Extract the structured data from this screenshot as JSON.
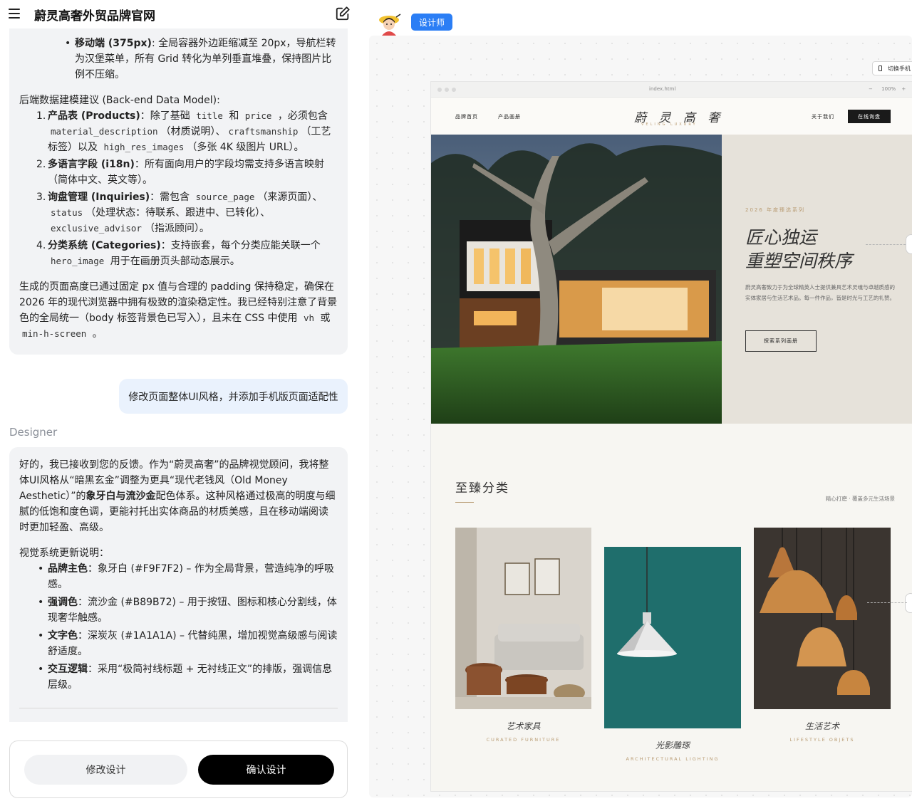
{
  "app": {
    "title": "蔚灵高奢外贸品牌官网"
  },
  "chat": {
    "msg1": {
      "mobile_bullet_bold": "移动端 (375px)",
      "mobile_bullet_text": ": 全局容器外边距缩减至 20px，导航栏转为汉堡菜单，所有 Grid 转化为单列垂直堆叠，保持图片比例不压缩。",
      "data_model_heading": "后端数据建模建议 (Back-end Data Model):",
      "items": [
        {
          "num": "1.",
          "bold": "产品表 (Products)",
          "parts": [
            "：除了基础 ",
            "title",
            " 和 ",
            "price",
            " ，必须包含 ",
            "material_description",
            "（材质说明）、",
            "craftsmanship",
            "（工艺标签）以及 ",
            "high_res_images",
            "（多张 4K 级图片 URL）。"
          ]
        },
        {
          "num": "2.",
          "bold": "多语言字段 (i18n)",
          "text": "：所有面向用户的字段均需支持多语言映射（简体中文、英文等）。"
        },
        {
          "num": "3.",
          "bold": "询盘管理 (Inquiries)",
          "parts": [
            "：需包含 ",
            "source_page",
            "（来源页面）、",
            "status",
            "（处理状态：待联系、跟进中、已转化）、",
            "exclusive_advisor",
            "（指派顾问）。"
          ]
        },
        {
          "num": "4.",
          "bold": "分类系统 (Categories)",
          "parts": [
            "：支持嵌套，每个分类应能关联一个 ",
            "hero_image",
            " 用于在画册页头部动态展示。"
          ]
        }
      ],
      "closing_a": "生成的页面高度已通过固定 px 值与合理的 padding 保持稳定，确保在 2026 年的现代浏览器中拥有极致的渲染稳定性。我已经特别注意了背景色的全局统一（body 标签背景色已写入），且未在 CSS 中使用 ",
      "closing_code1": "vh",
      "closing_b": " 或 ",
      "closing_code2": "min-h-screen",
      "closing_c": " 。"
    },
    "user_message": "修改页面整体UI风格，并添加手机版页面适配性",
    "designer_label": "Designer",
    "msg2": {
      "intro_a": "好的，我已接收到您的反馈。作为“蔚灵高奢”的品牌视觉顾问，我将整体UI风格从“暗黑玄金”调整为更具“现代老钱风（Old Money Aesthetic）”的",
      "intro_bold": "象牙白与流沙金",
      "intro_b": "配色体系。这种风格通过极高的明度与细腻的低饱和度色调，更能衬托出实体商品的材质美感，且在移动端阅读时更加轻盈、高级。",
      "section_heading": "视觉系统更新说明：",
      "bullets": [
        {
          "bold": "品牌主色",
          "text": "：象牙白 (#F9F7F2) – 作为全局背景，营造纯净的呼吸感。"
        },
        {
          "bold": "强调色",
          "text": "：流沙金 (#B89B72) – 用于按钮、图标和核心分割线，体现奢华触感。"
        },
        {
          "bold": "文字色",
          "text": "：深炭灰 (#1A1A1A) – 代替纯黑，增加视觉高级感与阅读舒适度。"
        },
        {
          "bold": "交互逻辑",
          "text": "：采用“极简衬线标题 + 无衬线正文”的排版，强调信息层级。"
        }
      ]
    },
    "actions": {
      "modify": "修改设计",
      "confirm": "确认设计"
    }
  },
  "canvas": {
    "role_badge": "设计师",
    "switch_mobile": "切换手机",
    "browser": {
      "url": "index.html",
      "zoom": "100%",
      "zoom_minus": "−",
      "zoom_plus": "+"
    },
    "site": {
      "nav": {
        "home": "品牌首页",
        "catalog": "产品画册",
        "about": "关于我们",
        "cta": "在线询盘"
      },
      "brand": {
        "logo": "蔚 灵 高 奢",
        "sub": "VELING LUXURY"
      },
      "hero": {
        "kicker": "2026 年度臻选系列",
        "title_line1": "匠心独运",
        "title_line2": "重塑空间秩序",
        "desc": "蔚灵高奢致力于为全球精英人士提供兼具艺术灵魂与卓越质感的实体家居与生活艺术品。每一件作品，皆是时光与工艺的礼赞。",
        "button": "探索系列画册"
      },
      "categories": {
        "title": "至臻分类",
        "subtitle": "精心打磨 · 覆盖多元生活场景",
        "items": [
          {
            "name": "艺术家具",
            "en": "CURATED FURNITURE"
          },
          {
            "name": "光影雕琢",
            "en": "ARCHITECTURAL LIGHTING"
          },
          {
            "name": "生活艺术",
            "en": "LIFESTYLE OBJETS"
          }
        ]
      }
    }
  },
  "colors": {
    "ivory": "#F9F7F2",
    "gold": "#B89B72",
    "charcoal": "#1A1A1A",
    "accent_blue": "#2B7EF5"
  }
}
